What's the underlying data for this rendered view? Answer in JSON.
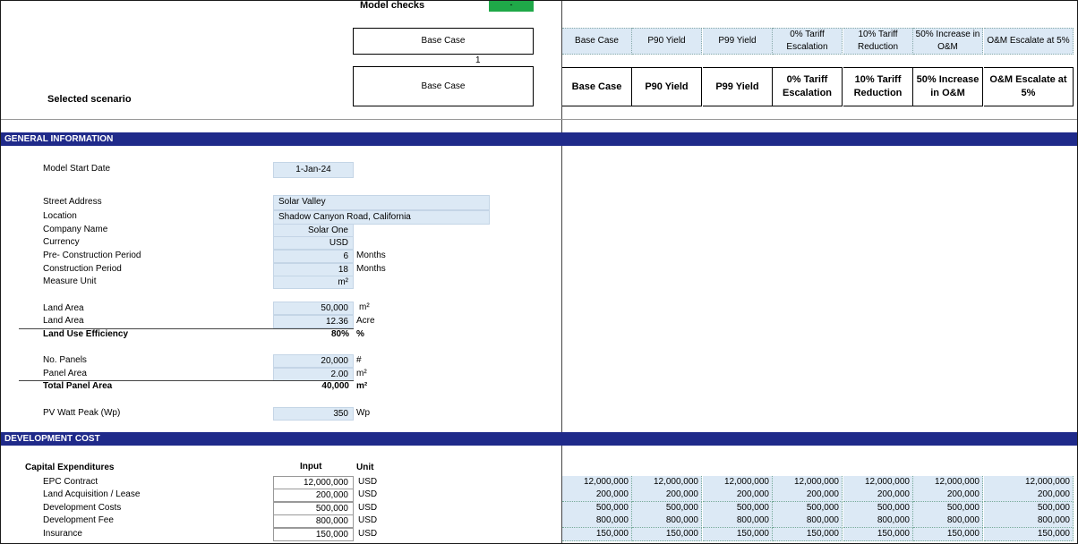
{
  "header": {
    "model_checks_label": "Model checks",
    "model_checks_value": "-",
    "scenario_top_box": "Base Case",
    "scenario_index": "1",
    "scenario_bottom_box": "Base Case",
    "selected_scenario_label": "Selected scenario",
    "check_color": "#1fa848"
  },
  "scenarios_top": [
    "Base Case",
    "P90 Yield",
    "P99 Yield",
    "0% Tariff Escalation",
    "10% Tariff Reduction",
    "50% Increase in O&M",
    "O&M Escalate at 5%"
  ],
  "scenarios_bottom": [
    "Base Case",
    "P90 Yield",
    "P99 Yield",
    "0% Tariff Escalation",
    "10% Tariff Reduction",
    "50% Increase in O&M",
    "O&M Escalate at 5%"
  ],
  "sections": {
    "general": "GENERAL INFORMATION",
    "development": "DEVELOPMENT COST",
    "section_color": "#1f2a8a"
  },
  "general": {
    "model_start_date_label": "Model Start Date",
    "model_start_date": "1-Jan-24",
    "street_address_label": "Street Address",
    "street_address": "Solar Valley",
    "location_label": "Location",
    "location": "Shadow Canyon Road, California",
    "company_label": "Company Name",
    "company": "Solar One",
    "currency_label": "Currency",
    "currency": "USD",
    "pre_construction_label": "Pre- Construction Period",
    "pre_construction": "6",
    "pre_construction_unit": "Months",
    "construction_label": "Construction Period",
    "construction": "18",
    "construction_unit": "Months",
    "measure_unit_label": "Measure Unit",
    "measure_unit": "m²",
    "land_area_label": "Land Area",
    "land_area_m2": "50,000",
    "land_area_m2_unit": "m²",
    "land_area_acre_label": "Land Area",
    "land_area_acre": "12.36",
    "land_area_acre_unit": "Acre",
    "land_use_eff_label": "Land Use Efficiency",
    "land_use_eff": "80%",
    "land_use_eff_unit": "%",
    "no_panels_label": "No. Panels",
    "no_panels": "20,000",
    "no_panels_unit": "#",
    "panel_area_label": "Panel Area",
    "panel_area": "2.00",
    "panel_area_unit": "m²",
    "total_panel_area_label": "Total Panel Area",
    "total_panel_area": "40,000",
    "total_panel_area_unit": "m²",
    "pv_watt_label": "PV Watt Peak (Wp)",
    "pv_watt": "350",
    "pv_watt_unit": "Wp"
  },
  "development": {
    "capex_label": "Capital Expenditures",
    "input_header": "Input",
    "unit_header": "Unit",
    "rows": [
      {
        "label": "EPC Contract",
        "input": "12,000,000",
        "unit": "USD",
        "scenarios": [
          "12,000,000",
          "12,000,000",
          "12,000,000",
          "12,000,000",
          "12,000,000",
          "12,000,000",
          "12,000,000"
        ]
      },
      {
        "label": "Land Acquisition / Lease",
        "input": "200,000",
        "unit": "USD",
        "scenarios": [
          "200,000",
          "200,000",
          "200,000",
          "200,000",
          "200,000",
          "200,000",
          "200,000"
        ]
      },
      {
        "label": "Development Costs",
        "input": "500,000",
        "unit": "USD",
        "scenarios": [
          "500,000",
          "500,000",
          "500,000",
          "500,000",
          "500,000",
          "500,000",
          "500,000"
        ]
      },
      {
        "label": "Development Fee",
        "input": "800,000",
        "unit": "USD",
        "scenarios": [
          "800,000",
          "800,000",
          "800,000",
          "800,000",
          "800,000",
          "800,000",
          "800,000"
        ]
      },
      {
        "label": "Insurance",
        "input": "150,000",
        "unit": "USD",
        "scenarios": [
          "150,000",
          "150,000",
          "150,000",
          "150,000",
          "150,000",
          "150,000",
          "150,000"
        ]
      }
    ]
  }
}
